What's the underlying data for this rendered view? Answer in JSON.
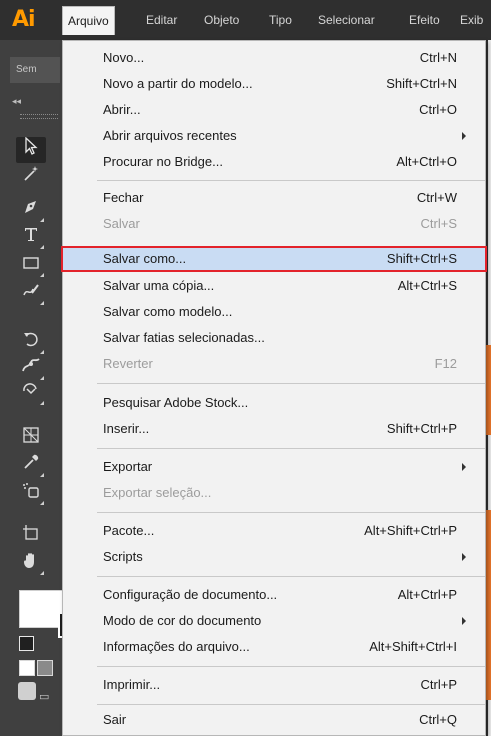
{
  "app": {
    "logo": "Ai",
    "accent": "#ff9a00",
    "highlight_border": "#e3232b",
    "highlight_fill": "#c9dcf3"
  },
  "menubar": {
    "items": [
      "Arquivo",
      "Editar",
      "Objeto",
      "Tipo",
      "Selecionar",
      "Efeito",
      "Exib"
    ],
    "active": "Arquivo"
  },
  "document_tab": {
    "label": "Sem"
  },
  "tools": [
    "selection-tool-icon",
    "magic-wand-icon",
    "pen-icon",
    "type-icon",
    "rectangle-icon",
    "shaper-icon",
    "rotate-icon",
    "puppet-warp-icon",
    "free-transform-icon",
    "shape-builder-icon",
    "eyedropper-icon",
    "symbol-sprayer-icon",
    "artboard-icon",
    "hand-icon"
  ],
  "arquivo_menu": {
    "items": [
      {
        "label": "Novo...",
        "shortcut": "Ctrl+N"
      },
      {
        "label": "Novo a partir do modelo...",
        "shortcut": "Shift+Ctrl+N"
      },
      {
        "label": "Abrir...",
        "shortcut": "Ctrl+O"
      },
      {
        "label": "Abrir arquivos recentes",
        "shortcut": ""
      },
      {
        "label": "Procurar no Bridge...",
        "shortcut": "Alt+Ctrl+O"
      },
      {
        "label": "Fechar",
        "shortcut": "Ctrl+W"
      },
      {
        "label": "Salvar",
        "shortcut": "Ctrl+S"
      },
      {
        "label": "Salvar como...",
        "shortcut": "Shift+Ctrl+S"
      },
      {
        "label": "Salvar uma cópia...",
        "shortcut": "Alt+Ctrl+S"
      },
      {
        "label": "Salvar como modelo...",
        "shortcut": ""
      },
      {
        "label": "Salvar fatias selecionadas...",
        "shortcut": ""
      },
      {
        "label": "Reverter",
        "shortcut": "F12"
      },
      {
        "label": "Pesquisar Adobe Stock...",
        "shortcut": ""
      },
      {
        "label": "Inserir...",
        "shortcut": "Shift+Ctrl+P"
      },
      {
        "label": "Exportar",
        "shortcut": ""
      },
      {
        "label": "Exportar seleção...",
        "shortcut": ""
      },
      {
        "label": "Pacote...",
        "shortcut": "Alt+Shift+Ctrl+P"
      },
      {
        "label": "Scripts",
        "shortcut": ""
      },
      {
        "label": "Configuração de documento...",
        "shortcut": "Alt+Ctrl+P"
      },
      {
        "label": "Modo de cor do documento",
        "shortcut": ""
      },
      {
        "label": "Informações do arquivo...",
        "shortcut": "Alt+Shift+Ctrl+I"
      },
      {
        "label": "Imprimir...",
        "shortcut": "Ctrl+P"
      },
      {
        "label": "Sair",
        "shortcut": "Ctrl+Q"
      }
    ],
    "highlighted": "Salvar como...",
    "disabled": [
      "Salvar",
      "Reverter",
      "Exportar seleção..."
    ],
    "submenus": [
      "Abrir arquivos recentes",
      "Exportar",
      "Scripts",
      "Modo de cor do documento"
    ]
  }
}
